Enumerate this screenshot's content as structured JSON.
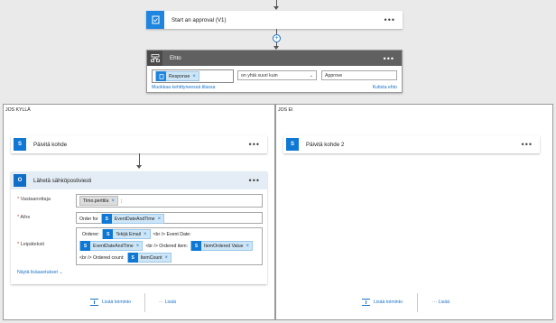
{
  "top_card": {
    "title": "Start an approval (V1)",
    "more": "•••",
    "color": "#1f85de"
  },
  "condition": {
    "title": "Ehto",
    "more": "•••",
    "token": "Response",
    "operator": "on yhtä suuri kuin",
    "value": "Approve",
    "advanced_link": "Muokkaa kehittyneessä tilassa",
    "collapse_link": "Kutista ehto"
  },
  "yes_branch": {
    "label": "JOS KYLLÄ",
    "update_card": {
      "title": "Päivitä kohde",
      "more": "•••"
    },
    "mail_card": {
      "title": "Lähetä sähköpostiviesti",
      "more": "•••",
      "to_label": "Vastaanottaja",
      "to_token": "Timo.perttila",
      "to_sep": ";",
      "subject_label": "Aihe",
      "subject_text": "Order for",
      "subject_token": "EventDateAndTime",
      "body_label": "Leipäteksti",
      "body_text1": "Orderer:",
      "body_token1": "Tekijä Email",
      "body_text2": "<br /> Event Date:",
      "body_token2": "EventDateAndTime",
      "body_text3": "<br /> Ordered item:",
      "body_token3": "ItemOrdered Value",
      "body_text4": "<br /> Ordered count:",
      "body_token4": "ItemCount",
      "advanced_link": "Näytä lisäasetukset"
    },
    "add_action": "Lisää toiminto",
    "more_action": "··· Lisää"
  },
  "no_branch": {
    "label": "JOS EI",
    "update_card": {
      "title": "Päivitä kohde 2",
      "more": "•••"
    },
    "add_action": "Lisää toiminto",
    "more_action": "··· Lisää"
  },
  "colors": {
    "sharepoint": "#0f78d4",
    "outlook": "#0f6fc6",
    "condition_header": "#606060",
    "link": "#1a73c8"
  }
}
